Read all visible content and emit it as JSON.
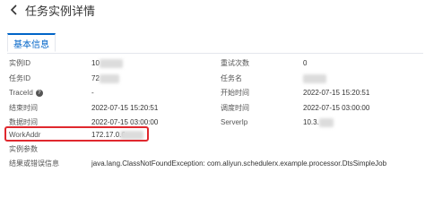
{
  "header": {
    "title": "任务实例详情"
  },
  "tabs": [
    {
      "label": "基本信息"
    }
  ],
  "left": [
    {
      "label": "实例ID",
      "value": "10"
    },
    {
      "label": "任务ID",
      "value": "72"
    },
    {
      "label": "TraceId",
      "value": "-"
    },
    {
      "label": "结束时间",
      "value": "2022-07-15 15:20:51"
    },
    {
      "label": "数据时间",
      "value": "2022-07-15 03:00:00"
    },
    {
      "label": "WorkAddr",
      "value": "172.17.0.6:"
    },
    {
      "label": "实例参数",
      "value": ""
    },
    {
      "label": "结果或错误信息",
      "value": "java.lang.ClassNotFoundException: com.aliyun.schedulerx.example.processor.DtsSimpleJob"
    }
  ],
  "right": [
    {
      "label": "重试次数",
      "value": "0"
    },
    {
      "label": "任务名",
      "value": ""
    },
    {
      "label": "开始时间",
      "value": "2022-07-15 15:20:51"
    },
    {
      "label": "调度时间",
      "value": "2022-07-15 03:00:00"
    },
    {
      "label": "ServerIp",
      "value": "10.3."
    }
  ],
  "colors": {
    "accent": "#0064c8",
    "highlight": "#e0282e"
  }
}
